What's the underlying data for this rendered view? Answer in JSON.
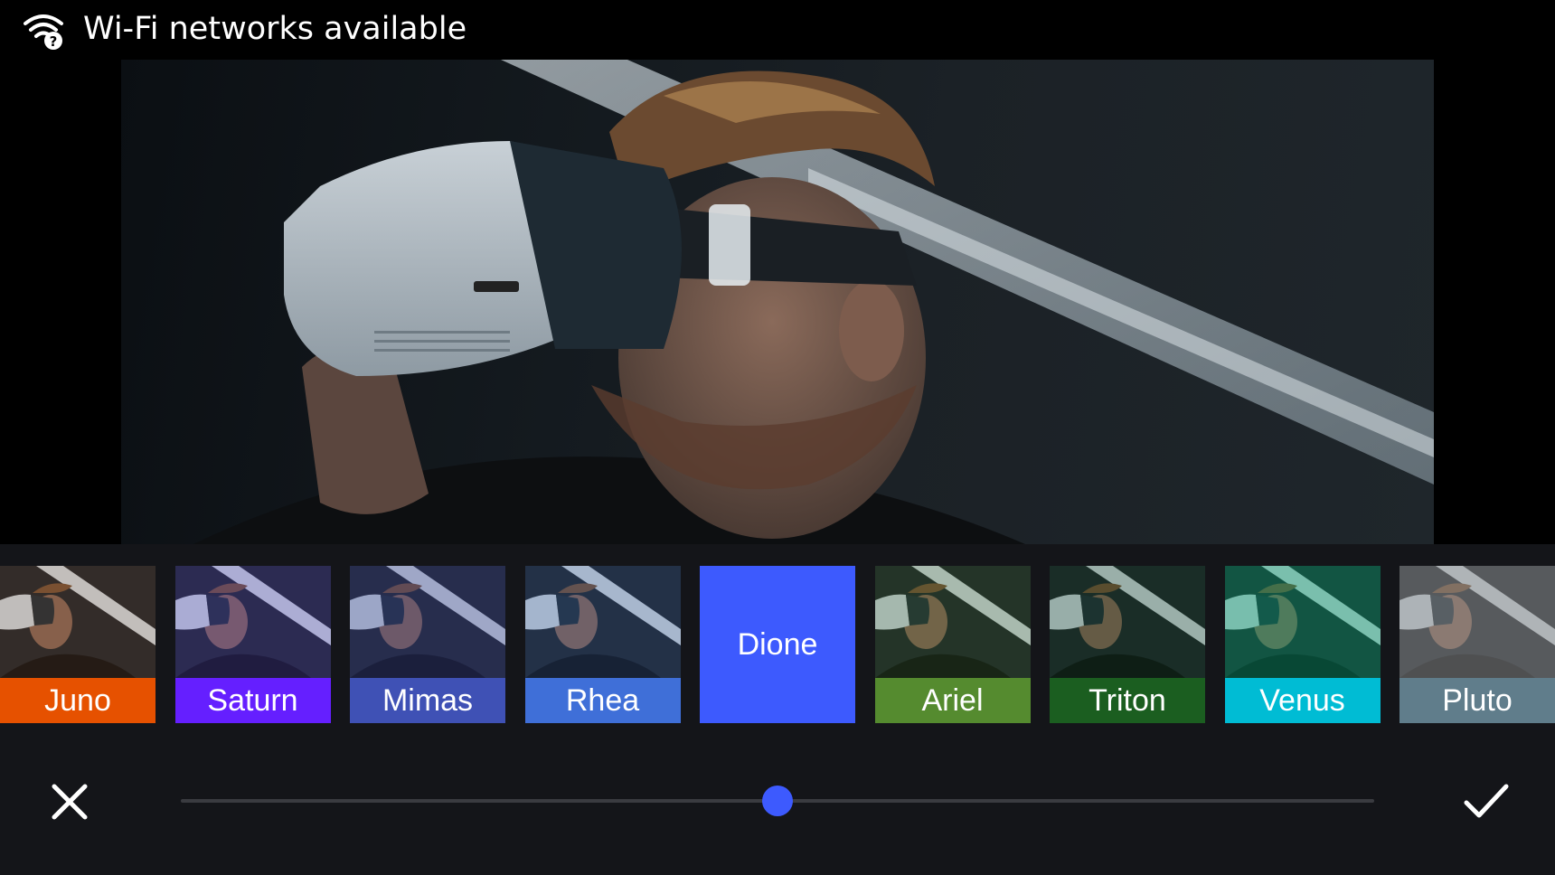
{
  "status_bar": {
    "text": "Wi-Fi networks available",
    "icon": "wifi-question-icon"
  },
  "photo": {
    "subject": "photo"
  },
  "filters": [
    {
      "label": "Juno",
      "color": "#e65100",
      "tint": "rgba(255,140,60,0.10)"
    },
    {
      "label": "Saturn",
      "color": "#651fff",
      "tint": "rgba(110,80,255,0.20)"
    },
    {
      "label": "Mimas",
      "color": "#3f51b5",
      "tint": "rgba(70,80,190,0.25)"
    },
    {
      "label": "Rhea",
      "color": "#3f6fd8",
      "tint": "rgba(70,120,220,0.18)"
    },
    {
      "label": "Dione",
      "color": "#3d5afe",
      "selected": true
    },
    {
      "label": "Ariel",
      "color": "#558b2f",
      "tint": "rgba(80,140,50,0.18)"
    },
    {
      "label": "Triton",
      "color": "#1b5e20",
      "tint": "rgba(20,90,40,0.20)"
    },
    {
      "label": "Venus",
      "color": "#00bcd4",
      "tint": "rgba(0,180,120,0.35)"
    },
    {
      "label": "Pluto",
      "color": "#607d8b",
      "tint": "rgba(160,160,160,0.45)"
    }
  ],
  "slider": {
    "value": 0.5
  },
  "actions": {
    "close_icon": "close-icon",
    "confirm_icon": "check-icon"
  },
  "colors": {
    "accent": "#3d5afe",
    "panel_bg": "#141519"
  }
}
